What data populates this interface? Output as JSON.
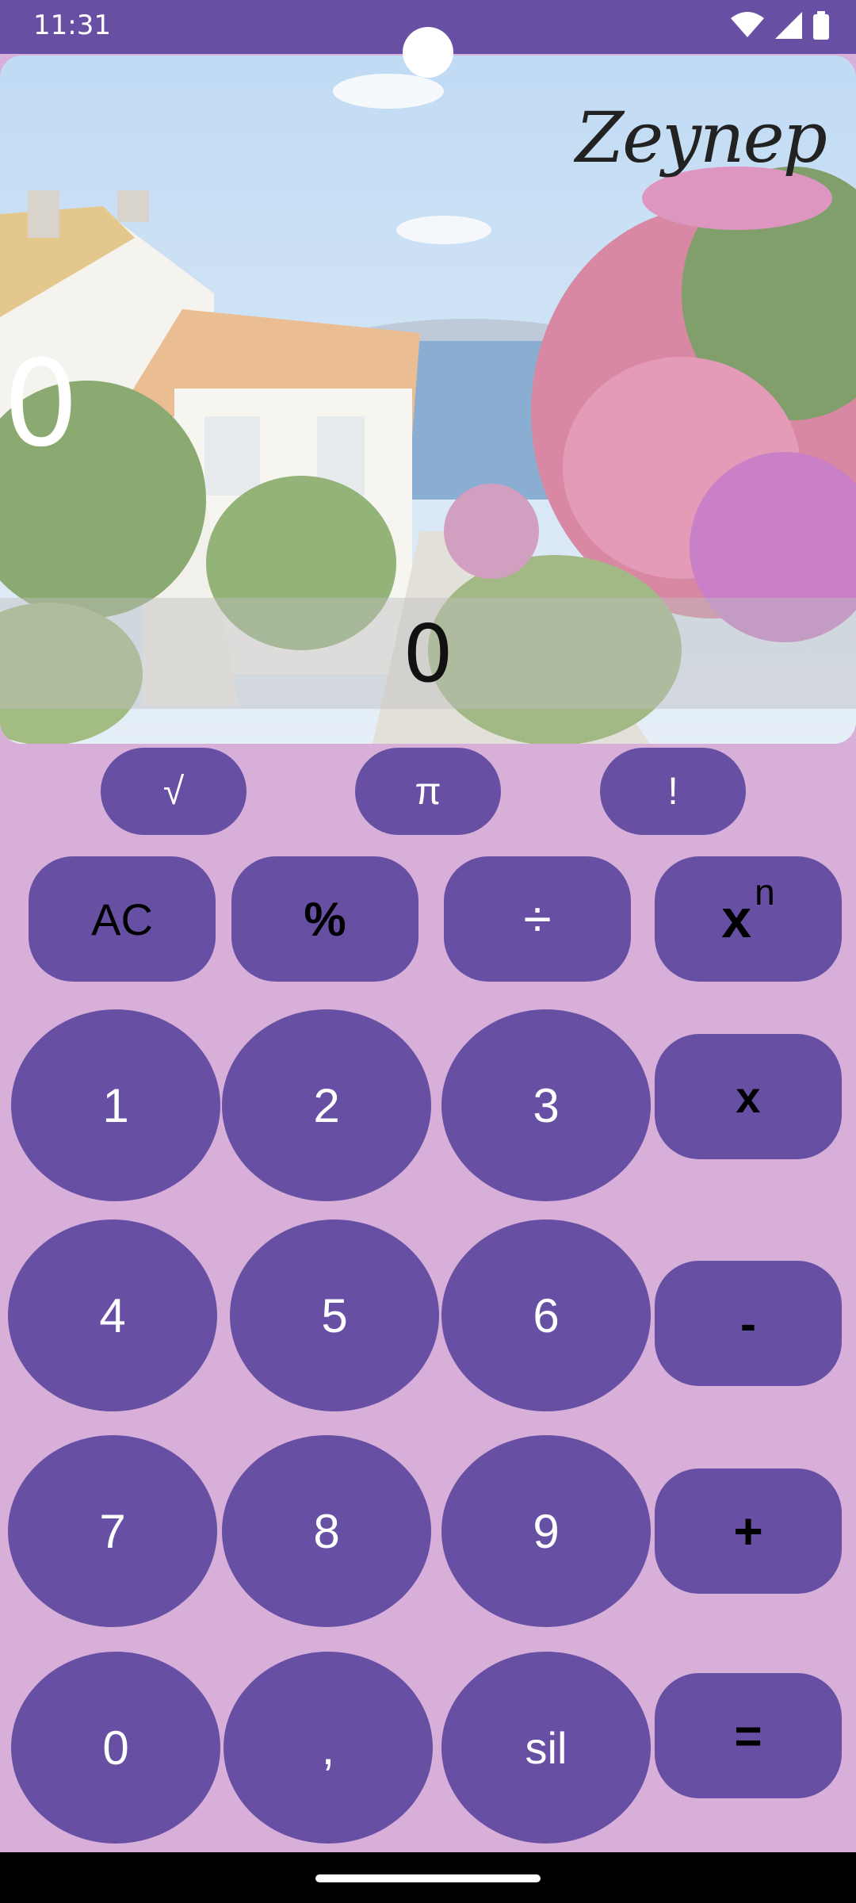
{
  "status_bar": {
    "time": "11:31"
  },
  "display": {
    "owner_name": "Zeynep",
    "expression": "0",
    "result": "0"
  },
  "scientific_row": [
    {
      "label": "√"
    },
    {
      "label": "π"
    },
    {
      "label": "!"
    }
  ],
  "keypad": {
    "ac": "AC",
    "percent": "%",
    "divide": "÷",
    "power_base": "x",
    "power_exp": "n",
    "multiply": "x",
    "minus": "-",
    "plus": "+",
    "equals": "=",
    "digits": [
      "0",
      "1",
      "2",
      "3",
      "4",
      "5",
      "6",
      "7",
      "8",
      "9"
    ],
    "comma": ",",
    "delete": "sil"
  },
  "colors": {
    "accent": "#6750a4",
    "background": "#d8afd8"
  }
}
